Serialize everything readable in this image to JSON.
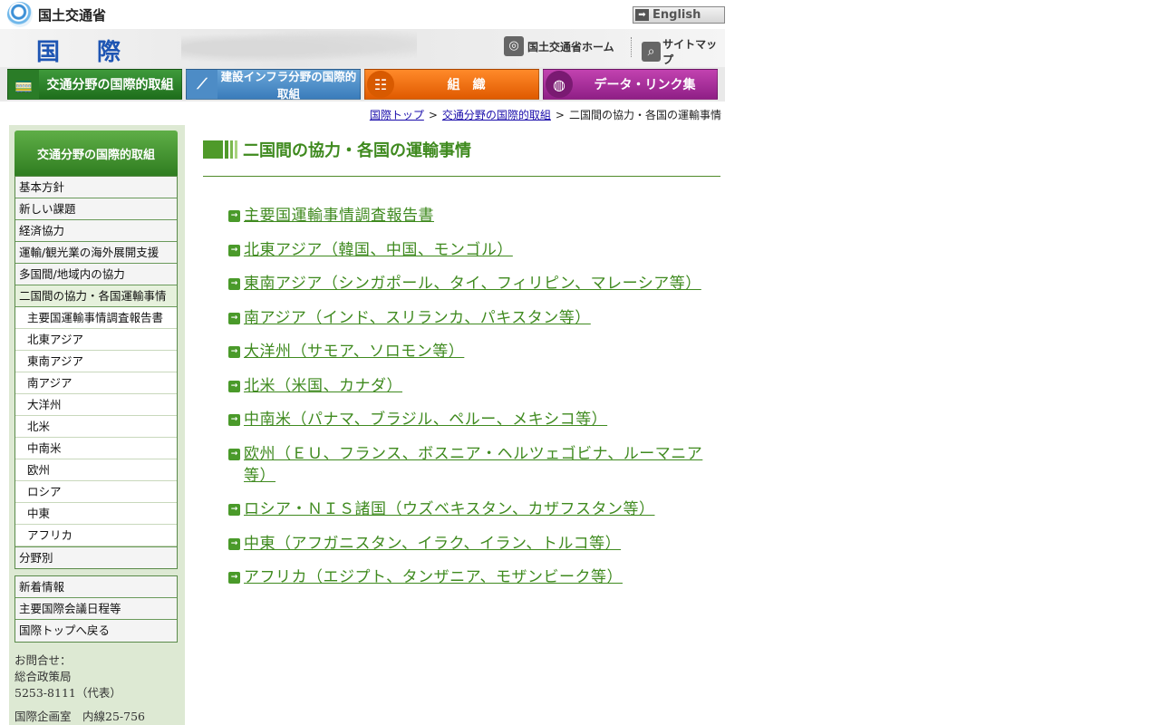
{
  "header": {
    "ministry_name": "国土交通省",
    "english_label": "English",
    "section_title": "国 際",
    "home_link": "国土交通省ホーム",
    "sitemap_link": "サイトマップ"
  },
  "main_nav": [
    {
      "label": "交通分野の国際的取組",
      "icon": "train-icon",
      "color": "#2f8a2b"
    },
    {
      "label": "建設インフラ分野の国際的取組",
      "icon": "road-icon",
      "color": "#4d8cc6"
    },
    {
      "label": "組　織",
      "icon": "org-chart-icon",
      "color": "#f06a10"
    },
    {
      "label": "データ・リンク集",
      "icon": "globe-icon",
      "color": "#a8309c"
    }
  ],
  "breadcrumb": {
    "items": [
      "国際トップ",
      "交通分野の国際的取組"
    ],
    "current": "二国間の協力・各国の運輸事情",
    "separator": ">"
  },
  "sidebar": {
    "header": "交通分野の国際的取組",
    "items": [
      "基本方針",
      "新しい課題",
      "経済協力",
      "運輸/観光業の海外展開支援",
      "多国間/地域内の協力",
      "二国間の協力・各国運輸事情"
    ],
    "sub_items": [
      "主要国運輸事情調査報告書",
      "北東アジア",
      "東南アジア",
      "南アジア",
      "大洋州",
      "北米",
      "中南米",
      "欧州",
      "ロシア",
      "中東",
      "アフリカ"
    ],
    "after_item": "分野別",
    "secondary_items": [
      "新着情報",
      "主要国際会議日程等",
      "国際トップへ戻る"
    ],
    "contact": {
      "heading": "お問合せ：",
      "dept": "総合政策局",
      "phone": "5253-8111（代表）",
      "office": "国際企画室　内線25-756"
    }
  },
  "content": {
    "title": "二国間の協力・各国の運輸事情",
    "links": [
      "主要国運輸事情調査報告書",
      "北東アジア（韓国、中国、モンゴル）",
      "東南アジア（シンガポール、タイ、フィリピン、マレーシア等）",
      "南アジア（インド、スリランカ、パキスタン等）",
      "大洋州（サモア、ソロモン等）",
      "北米（米国、カナダ）",
      "中南米（パナマ、ブラジル、ペルー、メキシコ等）",
      "欧州（ＥＵ、フランス、ボスニア・ヘルツェゴビナ、ルーマニア等）",
      "ロシア・ＮＩＳ諸国（ウズベキスタン、カザフスタン等）",
      "中東（アフガニスタン、イラク、イラン、トルコ等）",
      "アフリカ（エジプト、タンザニア、モザンビーク等）"
    ]
  },
  "colors": {
    "accent_green": "#3f8a1f",
    "link_blue": "#1a0dab",
    "sidebar_bg": "#dde9d3"
  }
}
